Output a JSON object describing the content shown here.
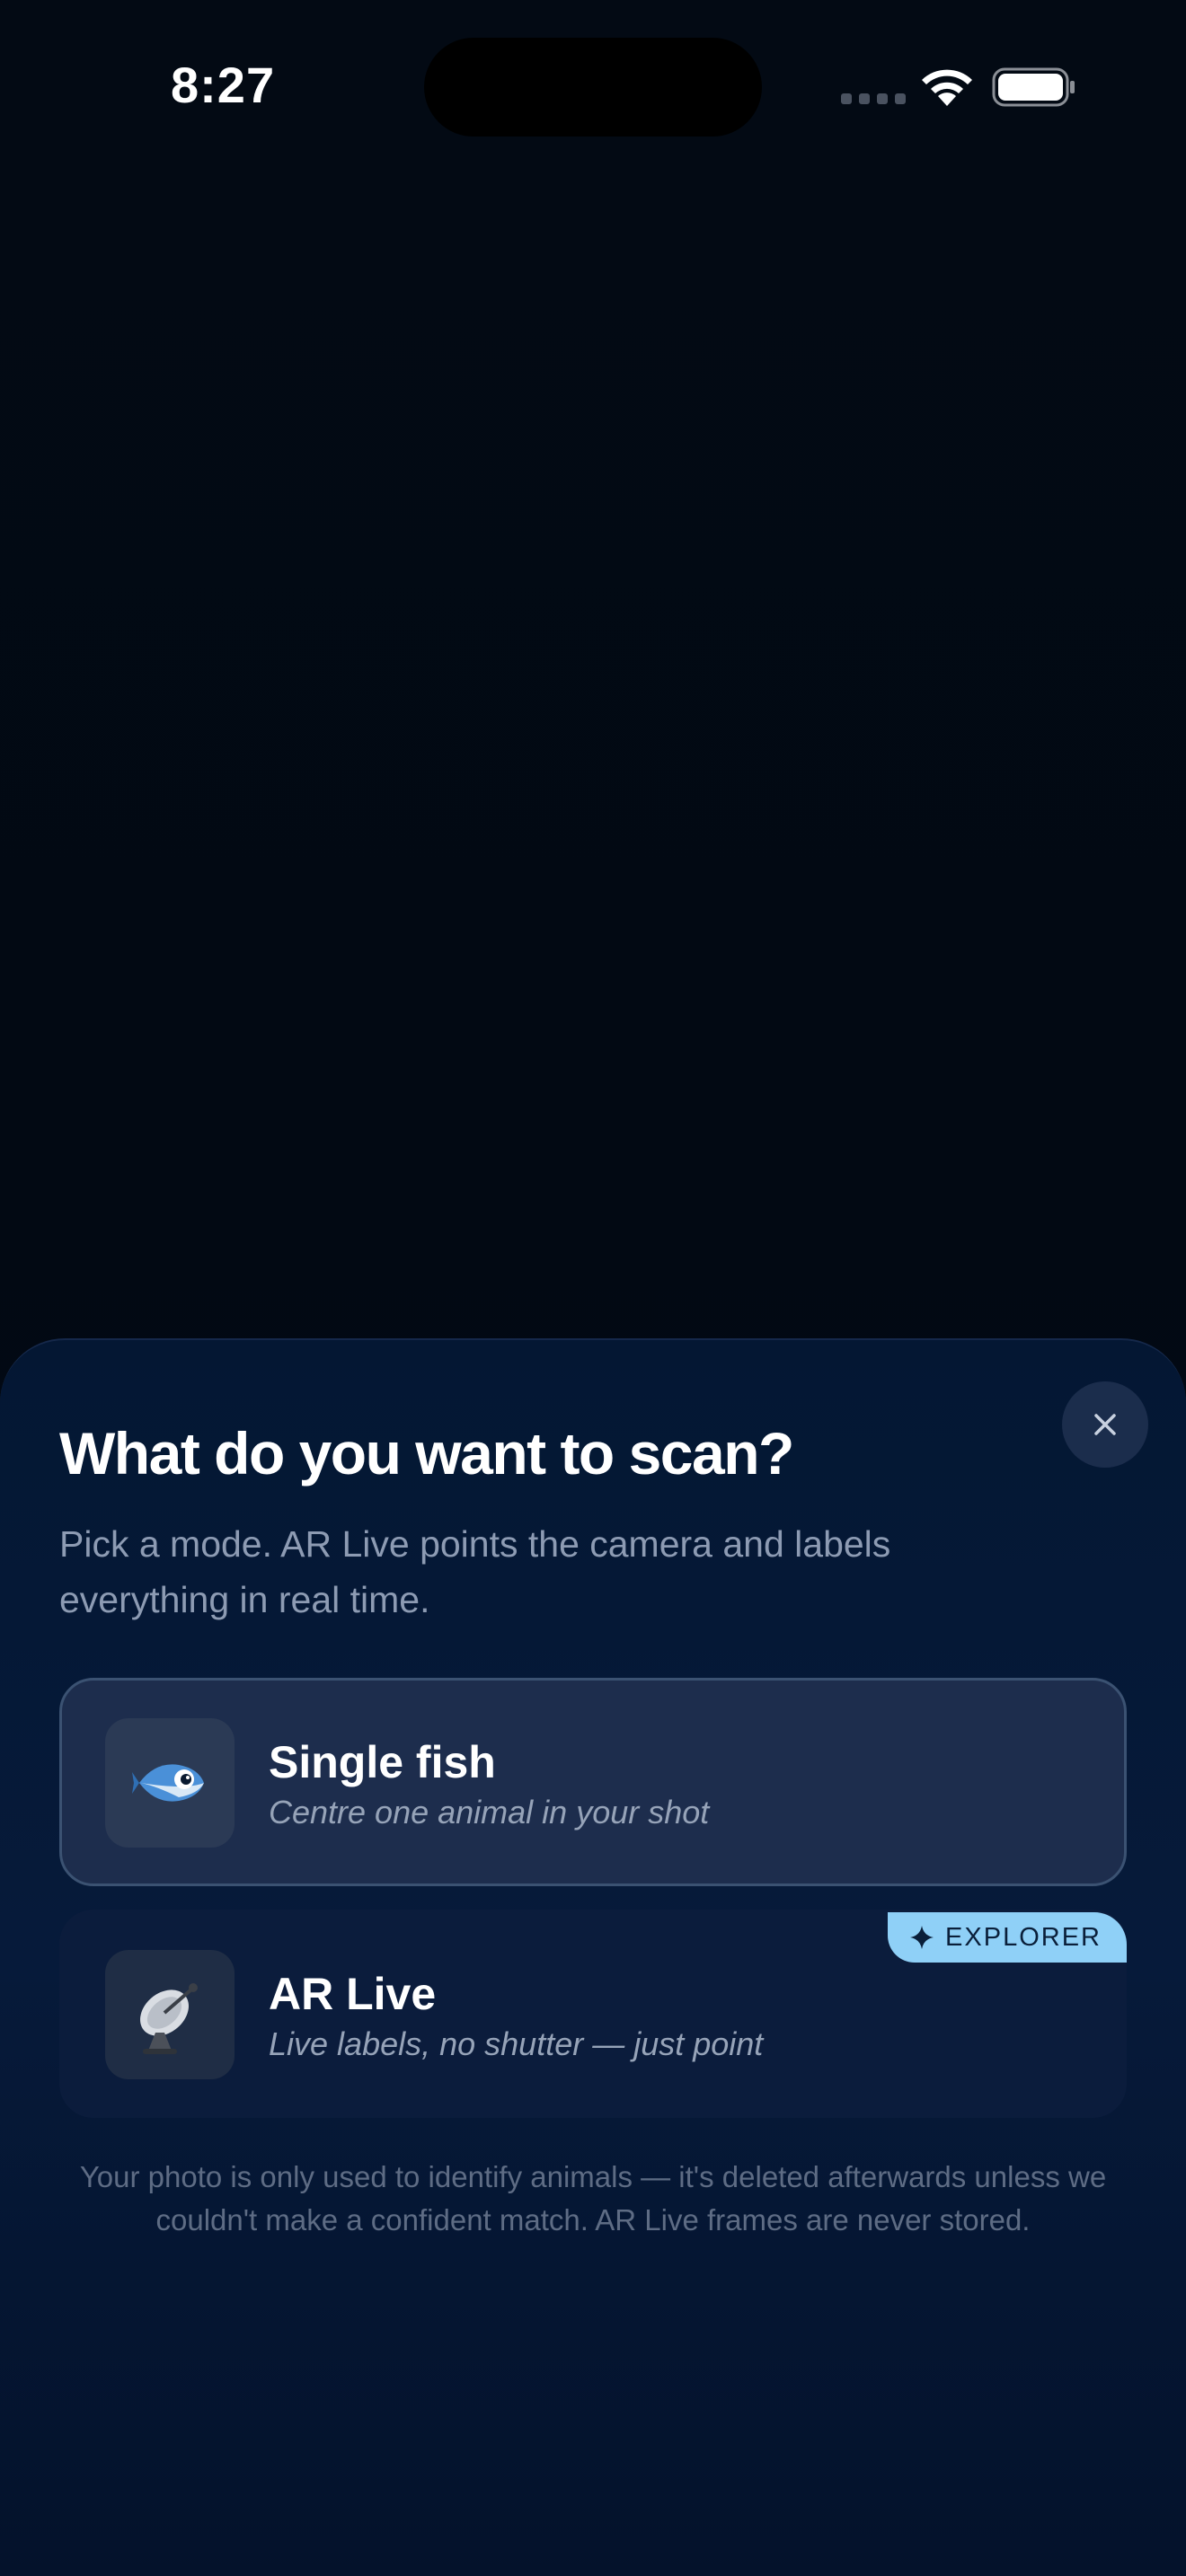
{
  "status_bar": {
    "time": "8:27",
    "icons": [
      "cellular-signal-icon",
      "wifi-icon",
      "battery-icon"
    ]
  },
  "sheet": {
    "title": "What do you want to scan?",
    "subtitle": "Pick a mode. AR Live points the camera and labels everything in real time.",
    "close_icon": "close-icon",
    "modes": [
      {
        "title": "Single fish",
        "description": "Centre one animal in your shot",
        "icon": "fish-icon",
        "selected": true
      },
      {
        "title": "AR Live",
        "description": "Live labels, no shutter — just point",
        "icon": "satellite-dish-icon",
        "badge": "EXPLORER",
        "badge_icon": "sparkle-icon",
        "selected": false
      }
    ],
    "privacy_note": "Your photo is only used to identify animals — it's deleted afterwards unless we couldn't make a confident match. AR Live frames are never stored."
  },
  "colors": {
    "background": "#030a14",
    "sheet": "#061a3a",
    "selected_card": "#1d2d4d",
    "badge": "#8fd0f7"
  }
}
